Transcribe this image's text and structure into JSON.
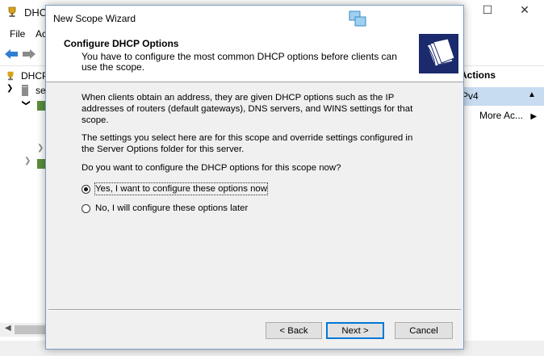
{
  "background_window": {
    "title": "DHCP",
    "menu": [
      "File",
      "Ac"
    ],
    "tree": [
      {
        "label": "DHCP"
      },
      {
        "label": "se"
      }
    ],
    "actions": {
      "header": "Actions",
      "section_label": "Pv4",
      "more_label": "More Ac..."
    }
  },
  "wizard": {
    "title": "New Scope Wizard",
    "heading": "Configure DHCP Options",
    "subheading": "You have to configure the most common DHCP options before clients can use the scope.",
    "paragraph1": "When clients obtain an address, they are given DHCP options such as the IP addresses of routers (default gateways), DNS servers, and WINS settings for that scope.",
    "paragraph2": "The settings you select here are for this scope and override settings configured in the Server Options folder for this server.",
    "question": "Do you want to configure the DHCP options for this scope now?",
    "options": [
      {
        "label": "Yes, I want to configure these options now",
        "selected": true
      },
      {
        "label": "No, I will configure these options later",
        "selected": false
      }
    ],
    "buttons": {
      "back": "< Back",
      "next": "Next >",
      "cancel": "Cancel"
    }
  },
  "colors": {
    "banner": "#1a2a6c",
    "actions_highlight": "#c7dcf0",
    "default_button_border": "#0078d7"
  }
}
